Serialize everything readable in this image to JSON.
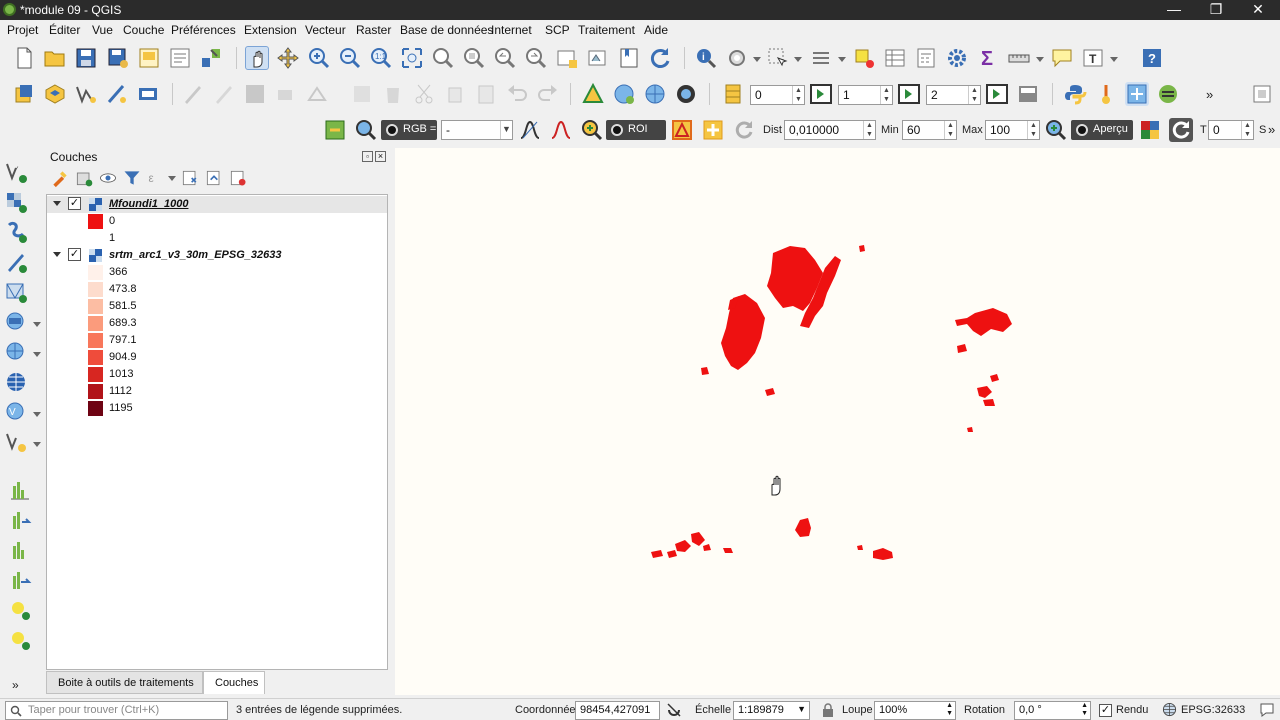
{
  "window": {
    "title": "*module 09 - QGIS",
    "controls": [
      "—",
      "❐",
      "✕"
    ]
  },
  "menubar": {
    "items": [
      "Projet",
      "Éditer",
      "Vue",
      "Couche",
      "Préférences",
      "Extension",
      "Vecteur",
      "Raster",
      "Base de données",
      "Internet",
      "SCP",
      "Traitement",
      "Aide"
    ]
  },
  "scp_toolbar": {
    "rgb_label": "RGB =",
    "rgb_value": "-",
    "roi_label": "ROI",
    "dist_label": "Dist",
    "dist_value": "0,010000",
    "min_label": "Min",
    "min_value": "60",
    "max_label": "Max",
    "max_value": "100",
    "preview_label": "Aperçu",
    "t_label": "T",
    "t_value": "0",
    "s_label": "S"
  },
  "band_spinners": {
    "band1": "0",
    "band2": "1",
    "band3": "2"
  },
  "layers_panel": {
    "title": "Couches",
    "layers": [
      {
        "name": "Mfoundi1_1000",
        "checked": true,
        "legend": [
          {
            "label": "0",
            "color": "#ee1111"
          },
          {
            "label": "1",
            "color": "#ffffff"
          }
        ]
      },
      {
        "name": "srtm_arc1_v3_30m_EPSG_32633",
        "checked": true,
        "legend": [
          {
            "label": "366",
            "color": "#fff1ea"
          },
          {
            "label": "473.8",
            "color": "#fddccd"
          },
          {
            "label": "581.5",
            "color": "#fcbda3"
          },
          {
            "label": "689.3",
            "color": "#fb9b7c"
          },
          {
            "label": "797.1",
            "color": "#f8775b"
          },
          {
            "label": "904.9",
            "color": "#ef4c3b"
          },
          {
            "label": "1013",
            "color": "#d72621"
          },
          {
            "label": "1112",
            "color": "#b11319"
          },
          {
            "label": "1195",
            "color": "#6e0313"
          }
        ]
      }
    ]
  },
  "bottom_tabs": [
    "Boite à outils de traitements",
    "Couches"
  ],
  "statusbar": {
    "search_placeholder": "Taper pour trouver (Ctrl+K)",
    "message": "3 entrées de légende supprimées.",
    "coord_label": "Coordonnée",
    "coord_value": "98454,427091",
    "scale_label": "Échelle",
    "scale_value": "1:189879",
    "magnifier_label": "Loupe",
    "magnifier_value": "100%",
    "rotation_label": "Rotation",
    "rotation_value": "0,0 °",
    "render_label": "Rendu",
    "crs": "EPSG:32633"
  },
  "colors": {
    "patch_red": "#ee1111",
    "map_bg": "#fffdf7"
  },
  "icons": [
    "qgis-logo-icon",
    "new-project-icon",
    "open-project-icon",
    "save-project-icon",
    "pan-icon",
    "zoom-in-icon",
    "zoom-out-icon",
    "identify-icon",
    "python-icon",
    "pan-hand-cursor-icon",
    "sum-icon",
    "help-icon"
  ]
}
